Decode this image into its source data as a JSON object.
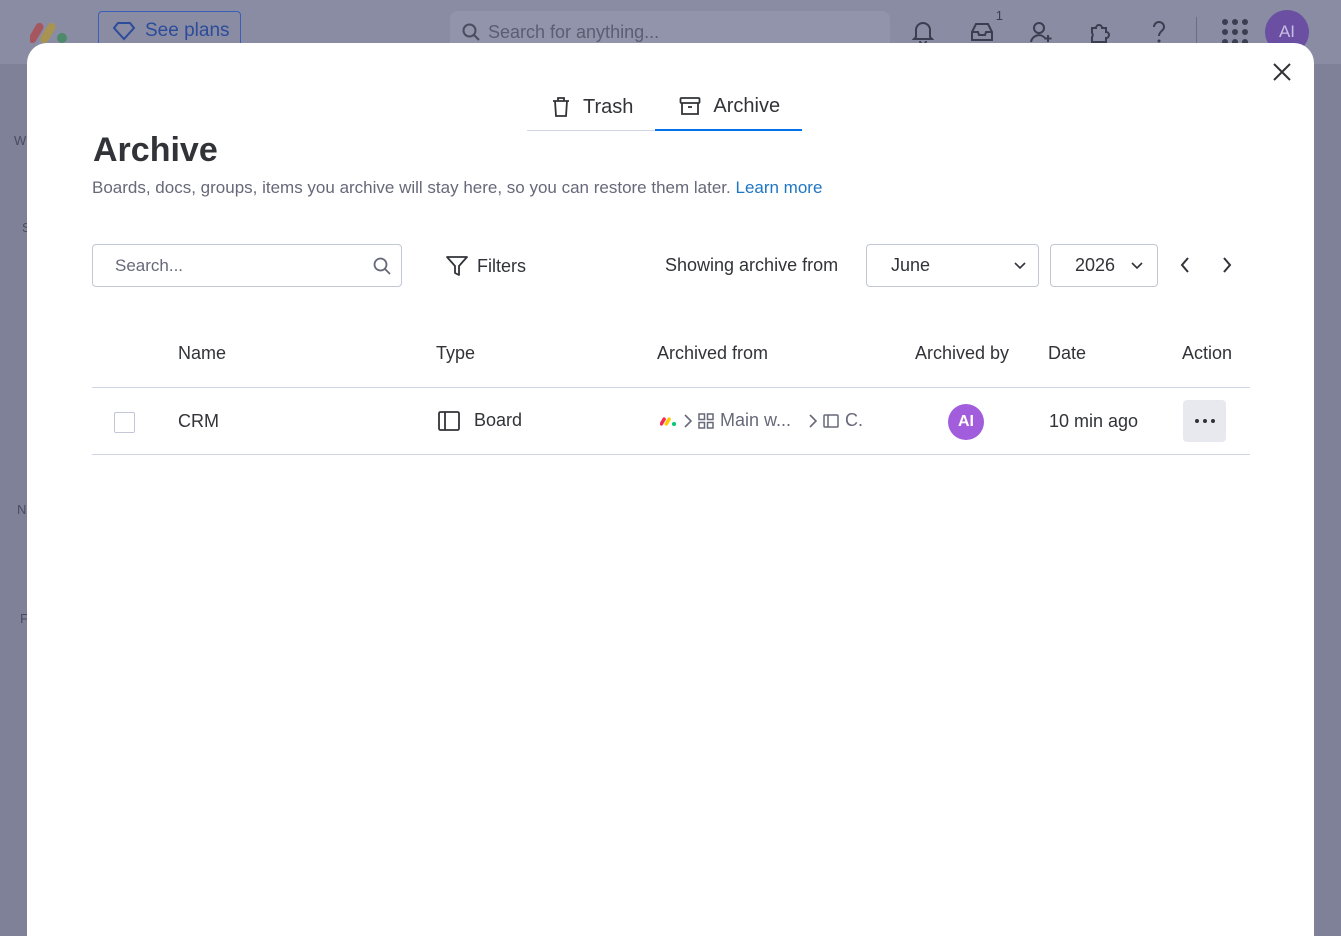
{
  "background": {
    "see_plans_label": "See plans",
    "search_placeholder": "Search for anything...",
    "inbox_badge": "1",
    "avatar_initials": "AI",
    "sidebar_letters": [
      "W",
      "S",
      "N",
      "F"
    ]
  },
  "tabs": [
    {
      "label": "Trash",
      "icon": "trash-icon",
      "active": false
    },
    {
      "label": "Archive",
      "icon": "archive-box-icon",
      "active": true
    }
  ],
  "page": {
    "title": "Archive",
    "description": "Boards, docs, groups, items you archive will stay here, so you can restore them later.",
    "learn_more": "Learn more"
  },
  "toolbar": {
    "search_placeholder": "Search...",
    "filters_label": "Filters",
    "showing_label": "Showing archive from",
    "month": "June",
    "year": "2026"
  },
  "table": {
    "columns": [
      "Name",
      "Type",
      "Archived from",
      "Archived by",
      "Date",
      "Action"
    ],
    "rows": [
      {
        "name": "CRM",
        "type": "Board",
        "archived_from": [
          "Main w...",
          "C."
        ],
        "archived_by_initials": "AI",
        "date": "10 min ago"
      }
    ]
  },
  "colors": {
    "accent": "#0073ea",
    "link": "#1f76c2",
    "avatar": "#a25ddc"
  }
}
